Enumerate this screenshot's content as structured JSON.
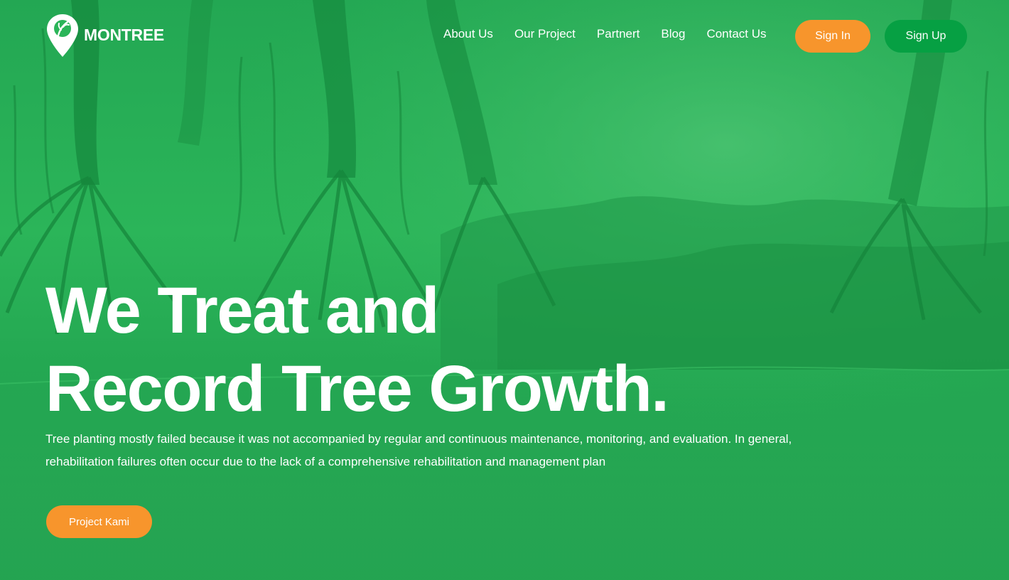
{
  "brand": {
    "name": "MONTREE",
    "logo_icon": "map-pin-leaf-icon"
  },
  "nav": {
    "items": [
      {
        "label": "About Us"
      },
      {
        "label": "Our Project"
      },
      {
        "label": "Partnert"
      },
      {
        "label": "Blog"
      },
      {
        "label": "Contact Us"
      }
    ]
  },
  "auth": {
    "sign_in_label": "Sign In",
    "sign_up_label": "Sign Up"
  },
  "hero": {
    "headline_line1": "We Treat and",
    "headline_line2": "Record Tree Growth.",
    "description": "Tree planting mostly failed because it was not accompanied by regular and continuous maintenance, monitoring, and evaluation. In general, rehabilitation failures often occur due to the lack of a comprehensive rehabilitation and management plan",
    "cta_label": "Project Kami"
  },
  "colors": {
    "overlay_green": "#2bb559",
    "accent_orange": "#f7952c",
    "signup_green": "#06a043",
    "text": "#ffffff"
  }
}
